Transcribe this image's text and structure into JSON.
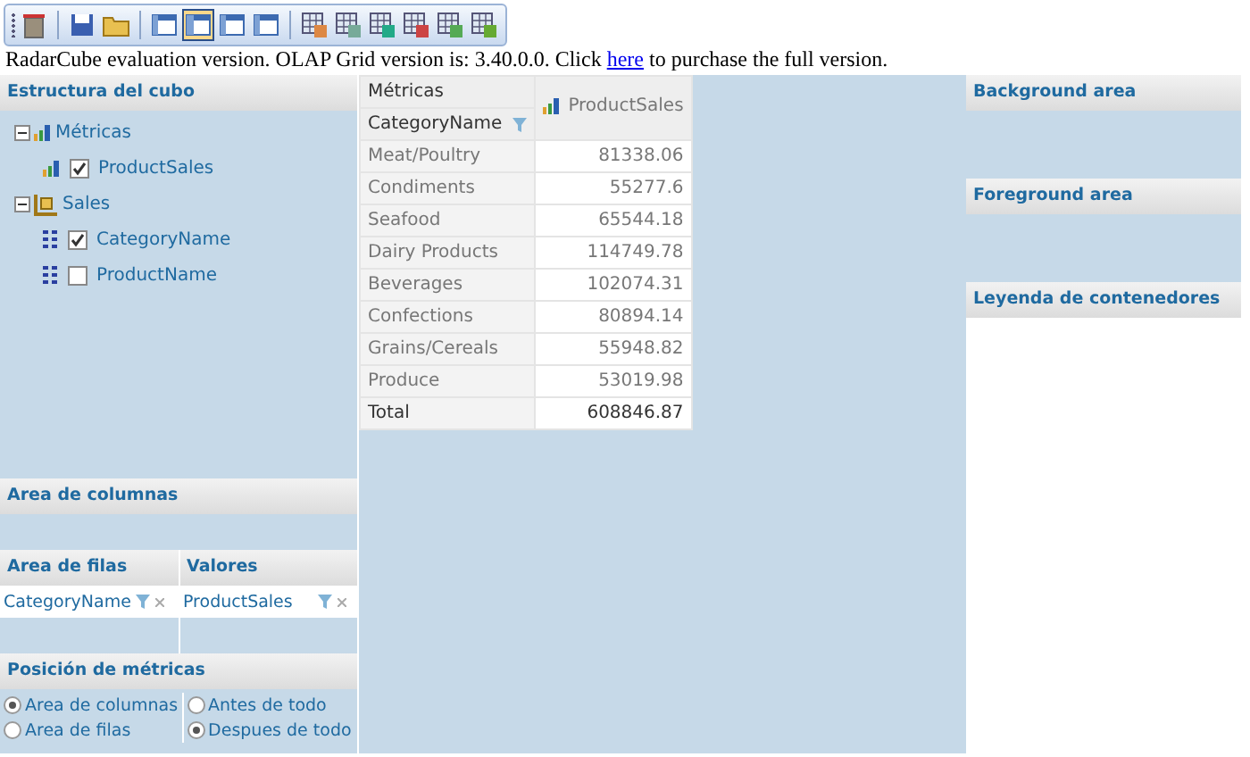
{
  "toolbar": {
    "groups": [
      [
        {
          "selected": false
        }
      ],
      [
        {
          "selected": false
        },
        {
          "selected": false
        }
      ],
      [
        {
          "selected": false
        },
        {
          "selected": true
        },
        {
          "selected": false
        },
        {
          "selected": false
        }
      ],
      [
        {
          "selected": false
        },
        {
          "selected": false
        },
        {
          "selected": false
        },
        {
          "selected": false
        },
        {
          "selected": false
        },
        {
          "selected": false
        }
      ]
    ]
  },
  "notice": {
    "before": "RadarCube evaluation version. OLAP Grid version is: 3.40.0.0. Click ",
    "link": "here",
    "after": " to purchase the full version."
  },
  "cube_structure": {
    "title": "Estructura del cubo",
    "tree": [
      {
        "label": "Métricas",
        "kind": "measures",
        "expanded": true,
        "children": [
          {
            "label": "ProductSales",
            "kind": "measure",
            "checked": true
          }
        ]
      },
      {
        "label": "Sales",
        "kind": "cube",
        "expanded": true,
        "children": [
          {
            "label": "CategoryName",
            "kind": "hierarchy",
            "checked": true
          },
          {
            "label": "ProductName",
            "kind": "hierarchy",
            "checked": false
          }
        ]
      }
    ]
  },
  "column_area": {
    "title": "Area de columnas"
  },
  "row_area": {
    "title": "Area de filas",
    "items": [
      "CategoryName"
    ]
  },
  "values_area": {
    "title": "Valores",
    "items": [
      "ProductSales"
    ]
  },
  "measure_position": {
    "title": "Posición de métricas",
    "groups": [
      [
        {
          "label": "Area de columnas",
          "selected": true
        },
        {
          "label": "Area de filas",
          "selected": false
        }
      ],
      [
        {
          "label": "Antes de todo",
          "selected": false
        },
        {
          "label": "Despues de todo",
          "selected": true
        }
      ]
    ]
  },
  "grid": {
    "corner": "Métricas",
    "row_header": "CategoryName",
    "column_header": "ProductSales",
    "rows": [
      {
        "label": "Meat/Poultry",
        "value": "81338.06",
        "kind": "item"
      },
      {
        "label": "Condiments",
        "value": "55277.6",
        "kind": "item"
      },
      {
        "label": "Seafood",
        "value": "65544.18",
        "kind": "item"
      },
      {
        "label": "Dairy Products",
        "value": "114749.78",
        "kind": "item"
      },
      {
        "label": "Beverages",
        "value": "102074.31",
        "kind": "item"
      },
      {
        "label": "Confections",
        "value": "80894.14",
        "kind": "item"
      },
      {
        "label": "Grains/Cereals",
        "value": "55948.82",
        "kind": "item"
      },
      {
        "label": "Produce",
        "value": "53019.98",
        "kind": "item"
      },
      {
        "label": "Total",
        "value": "608846.87",
        "kind": "total"
      }
    ]
  },
  "right_panels": [
    {
      "title": "Background area",
      "kind": "area"
    },
    {
      "title": "Foreground area",
      "kind": "area"
    },
    {
      "title": "Leyenda de contenedores",
      "kind": "legend"
    }
  ]
}
